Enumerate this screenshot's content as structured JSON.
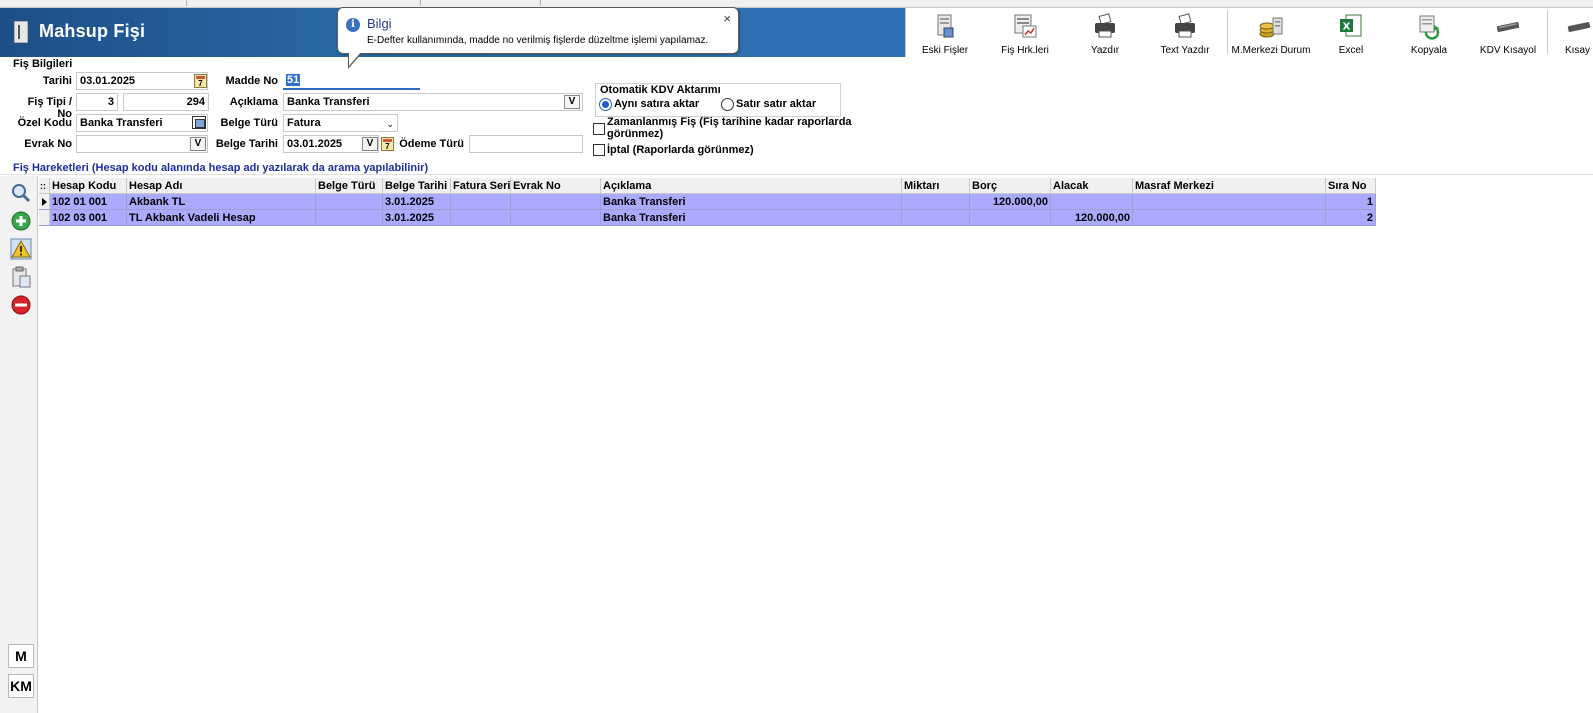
{
  "window": {
    "title": "Mahsup Fişi"
  },
  "toolbar": {
    "buttons": [
      {
        "label": "Eski Fişler",
        "icon": "old-slips-icon"
      },
      {
        "label": "Fiş Hrk.leri",
        "icon": "slip-movements-icon"
      },
      {
        "label": "Yazdır",
        "icon": "printer-icon"
      },
      {
        "label": "Text Yazdır",
        "icon": "text-printer-icon"
      },
      {
        "label": "M.Merkezi Durum",
        "icon": "coins-icon"
      },
      {
        "label": "Excel",
        "icon": "excel-icon"
      },
      {
        "label": "Kopyala",
        "icon": "copy-icon"
      },
      {
        "label": "KDV Kısayol",
        "icon": "vat-shortcut-icon"
      },
      {
        "label": "Kısay",
        "icon": "shortcut-icon"
      }
    ]
  },
  "tooltip": {
    "title": "Bilgi",
    "message": "E-Defter kullanımında, madde no verilmiş fişlerde düzeltme işlemi yapılamaz.",
    "close": "×"
  },
  "form": {
    "section_title": "Fiş Bilgileri",
    "tarihi_label": "Tarihi",
    "tarihi_value": "03.01.2025",
    "madde_no_label": "Madde No",
    "madde_no_value": "51",
    "fis_tipi_label": "Fiş Tipi / No",
    "fis_tipi_value": "3",
    "fis_no_value": "294",
    "aciklama_label": "Açıklama",
    "aciklama_value": "Banka Transferi",
    "ozel_kodu_label": "Özel Kodu",
    "ozel_kodu_value": "Banka Transferi",
    "belge_turu_label": "Belge Türü",
    "belge_turu_value": "Fatura",
    "evrak_no_label": "Evrak No",
    "evrak_no_value": "",
    "belge_tarihi_label": "Belge Tarihi",
    "belge_tarihi_value": "03.01.2025",
    "odeme_turu_label": "Ödeme Türü",
    "odeme_turu_value": "",
    "v_label": "V",
    "cal_day": "7"
  },
  "kdv": {
    "title": "Otomatik KDV Aktarımı",
    "option_same": "Aynı satıra aktar",
    "option_row": "Satır satır aktar",
    "selected": "Aynı satıra aktar"
  },
  "options": {
    "zamanlanmis": "Zamanlanmış Fiş (Fiş tarihine kadar raporlarda görünmez)",
    "zamanlanmis_checked": false,
    "iptal": "İptal (Raporlarda görünmez)",
    "iptal_checked": false
  },
  "movements": {
    "title": "Fiş Hareketleri (Hesap kodu alanında hesap adı yazılarak da arama yapılabilinir)",
    "indicator_header": "::",
    "columns": [
      "Hesap Kodu",
      "Hesap Adı",
      "Belge Türü",
      "Belge Tarihi",
      "Fatura Seri",
      "Evrak No",
      "Açıklama",
      "Miktarı",
      "Borç",
      "Alacak",
      "Masraf Merkezi",
      "Sıra No"
    ],
    "rows": [
      {
        "hesap_kodu": "102 01 001",
        "hesap_adi": "Akbank TL",
        "belge_turu": "",
        "belge_tarihi": "3.01.2025",
        "fatura_seri": "",
        "evrak_no": "",
        "aciklama": "Banka Transferi",
        "miktari": "",
        "borc": "120.000,00",
        "alacak": "",
        "masraf_merkezi": "",
        "sira_no": "1"
      },
      {
        "hesap_kodu": "102 03 001",
        "hesap_adi": "TL Akbank Vadeli Hesap",
        "belge_turu": "",
        "belge_tarihi": "3.01.2025",
        "fatura_seri": "",
        "evrak_no": "",
        "aciklama": "Banka Transferi",
        "miktari": "",
        "borc": "",
        "alacak": "120.000,00",
        "masraf_merkezi": "",
        "sira_no": "2"
      }
    ]
  },
  "side": {
    "buttons": [
      {
        "icon": "search-icon"
      },
      {
        "icon": "add-icon"
      },
      {
        "icon": "warning-icon"
      },
      {
        "icon": "clipboard-icon"
      },
      {
        "icon": "delete-icon"
      }
    ],
    "m_label": "M",
    "km_label": "KM"
  }
}
